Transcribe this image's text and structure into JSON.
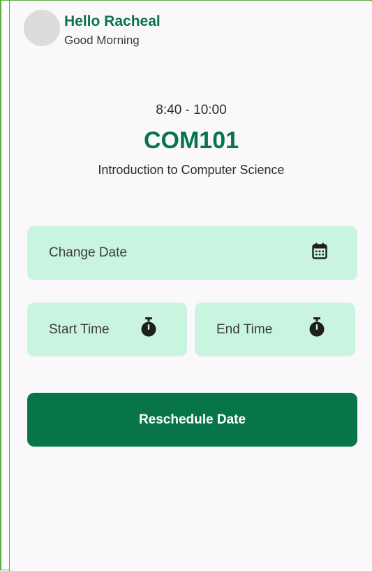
{
  "header": {
    "greeting": "Hello Racheal",
    "subtitle": "Good Morning"
  },
  "course": {
    "time": "8:40 - 10:00",
    "code": "COM101",
    "name": "Introduction to Computer Science"
  },
  "form": {
    "change_date_label": "Change Date",
    "start_time_label": "Start Time",
    "end_time_label": "End Time",
    "submit_label": "Reschedule Date"
  },
  "icons": {
    "date": "calendar-icon",
    "start": "stopwatch-icon",
    "end": "stopwatch-icon"
  },
  "colors": {
    "primary": "#087548",
    "field_bg": "#c8f4e0",
    "background": "#fbf8fc",
    "frame": "#5fae3f"
  }
}
